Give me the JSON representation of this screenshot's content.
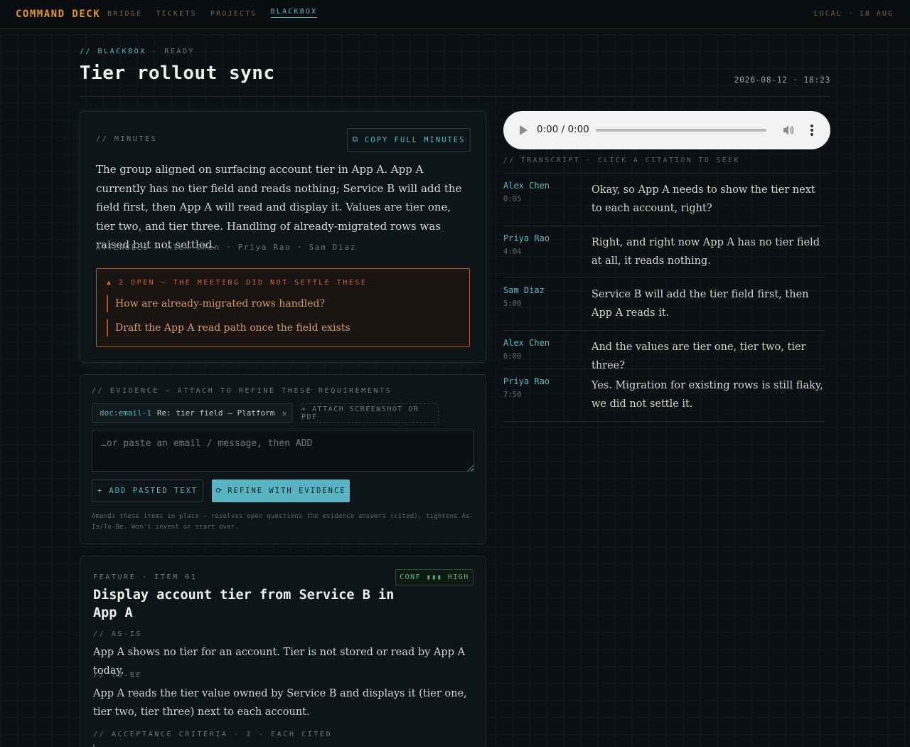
{
  "brand": "COMMAND DECK",
  "nav": {
    "items": [
      "BRIDGE",
      "TICKETS",
      "PROJECTS",
      "BLACKBOX"
    ]
  },
  "topbar": {
    "right": "LOCAL · 18 AUG"
  },
  "header": {
    "crumb_section": "// BLACKBOX",
    "crumb_status": " · READY",
    "title": "Tier rollout sync",
    "datetime": "2026-08-12 · 18:23"
  },
  "minutes": {
    "label": "// MINUTES",
    "copy_icon": "⧉",
    "copy_label": "COPY FULL MINUTES",
    "text": "The group aligned on surfacing account tier in App A. App A currently has no tier field and reads nothing; Service B will add the field first, then App A will read and display it. Values are tier one, tier two, and tier three. Handling of already-migrated rows was raised but not settled.",
    "attendees": "ATTENDEES · Alex Chen · Priya Rao · Sam Diaz",
    "open_heading": "▲ 2 OPEN — THE MEETING DID NOT SETTLE THESE",
    "open_items": [
      "How are already-migrated rows handled?",
      "Draft the App A read path once the field exists"
    ]
  },
  "evidence": {
    "label": "// EVIDENCE — ATTACH TO REFINE THESE REQUIREMENTS",
    "chip_id": "doc:email-1",
    "chip_name": "Re: tier field — Platform",
    "chip_close": "✕",
    "attach_label": "+ ATTACH SCREENSHOT OR PDF",
    "paste_placeholder": "…or paste an email / message, then ADD",
    "add_label": "+ ADD PASTED TEXT",
    "refine_icon": "⟳",
    "refine_label": "REFINE WITH EVIDENCE",
    "note": "Amends these items in place — resolves open questions the evidence answers (cited), tightens As-Is/To-Be. Won't invent or start over."
  },
  "feature": {
    "label": "FEATURE · ITEM 01",
    "conf": "CONF ▮▮▮ HIGH",
    "title": "Display account tier from Service B in App A",
    "as_is_label": "// AS-IS",
    "as_is": "App A shows no tier for an account. Tier is not stored or read by App A today.",
    "to_be_label": "// TO-BE",
    "to_be": "App A reads the tier value owned by Service B and displays it (tier one, tier two, tier three) next to each account.",
    "criteria_label": "// ACCEPTANCE CRITERIA · 2 · EACH CITED"
  },
  "audio": {
    "time": "0:00 / 0:00"
  },
  "transcript": {
    "label": "// TRANSCRIPT · CLICK A CITATION TO SEEK",
    "entries": [
      {
        "speaker": "Alex Chen",
        "time": "0:05",
        "text": "Okay, so App A needs to show the tier next to each account, right?"
      },
      {
        "speaker": "Priya Rao",
        "time": "4:04",
        "text": "Right, and right now App A has no tier field at all, it reads nothing."
      },
      {
        "speaker": "Sam Diaz",
        "time": "5:00",
        "text": "Service B will add the tier field first, then App A reads it."
      },
      {
        "speaker": "Alex Chen",
        "time": "6:00",
        "text": "And the values are tier one, tier two, tier three?"
      },
      {
        "speaker": "Priya Rao",
        "time": "7:50",
        "text": "Yes. Migration for existing rows is still flaky, we did not settle it."
      }
    ]
  },
  "colors": {
    "accent_cyan": "#5fb6c4",
    "brand_amber": "#e0962a",
    "warning_orange": "#d2623a",
    "confidence_green": "#5db372",
    "background": "#0b1013"
  }
}
